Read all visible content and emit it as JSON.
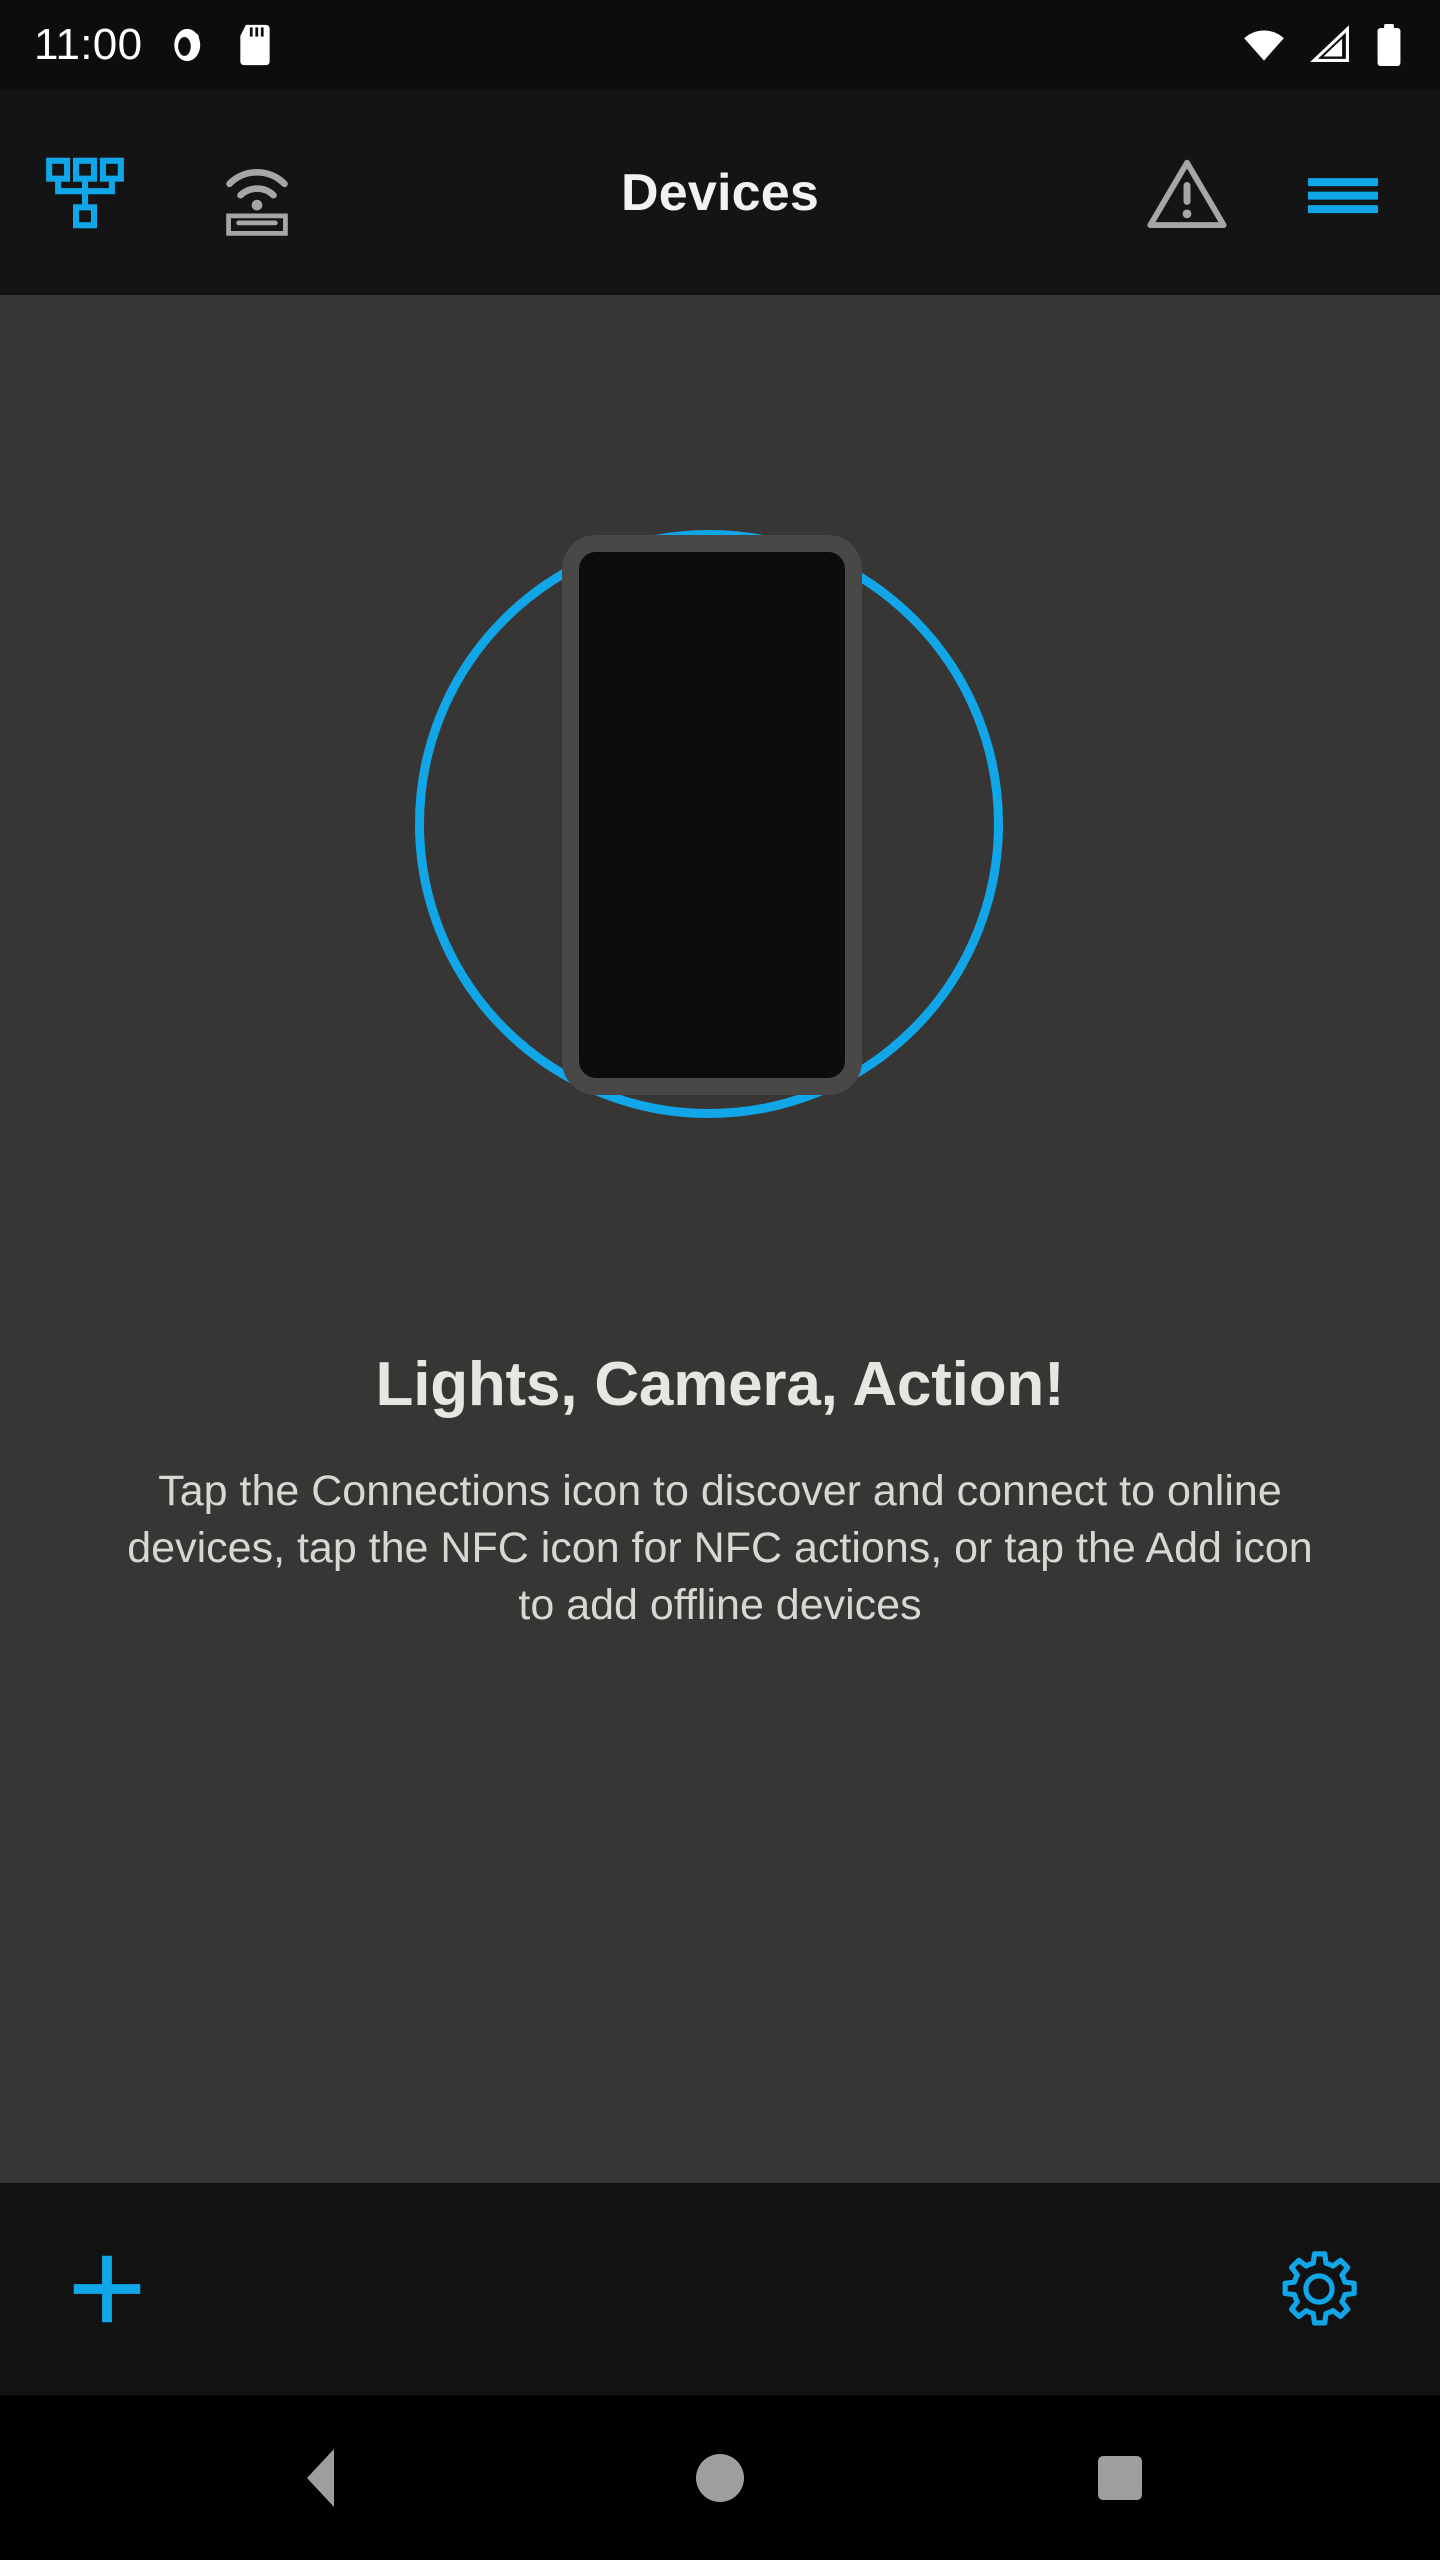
{
  "status_bar": {
    "clock": "11:00",
    "left_icons": [
      {
        "name": "do-not-disturb-icon"
      },
      {
        "name": "sd-card-icon"
      }
    ],
    "right_icons": [
      {
        "name": "wifi-icon"
      },
      {
        "name": "cellular-signal-icon"
      },
      {
        "name": "battery-icon"
      }
    ]
  },
  "app_bar": {
    "title": "Devices",
    "connections_icon": "connections-icon",
    "nfc_icon": "nfc-icon",
    "warning_icon": "warning-triangle-icon",
    "menu_icon": "hamburger-menu-icon"
  },
  "empty_state": {
    "illustration": "phone-in-circle-illustration",
    "heading": "Lights, Camera, Action!",
    "body": "Tap the Connections icon to discover and connect to online devices, tap the NFC icon for NFC actions, or tap the Add icon to add offline devices"
  },
  "bottom_bar": {
    "add_icon": "plus-icon",
    "settings_icon": "gear-icon"
  },
  "nav_bar": {
    "back": "back-triangle-icon",
    "home": "home-circle-icon",
    "recents": "recents-square-icon"
  },
  "colors": {
    "accent_blue": "#11A6E8",
    "app_bar_bg": "#141414",
    "content_bg": "#383634",
    "bottom_bar_bg": "#121212",
    "status_bar_bg": "#0D0D0D",
    "nav_bar_bg": "#000000",
    "icon_gray": "#A8A6A4",
    "heading_text": "#E8E6E3",
    "body_text": "#D9D7D4"
  }
}
